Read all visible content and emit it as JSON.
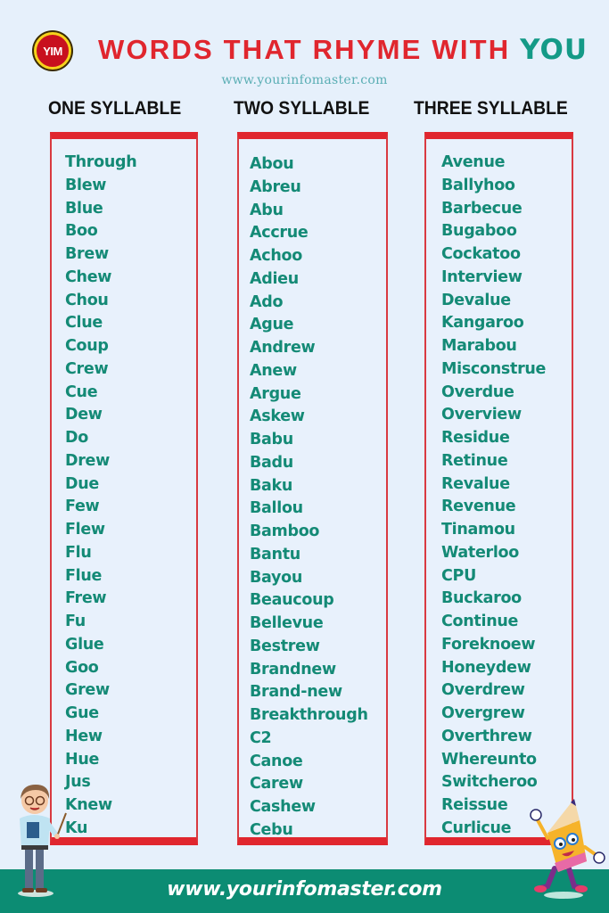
{
  "header": {
    "logo_text": "YIM",
    "title_main": "WORDS THAT RHYME WITH ",
    "title_accent": "YOU",
    "subtitle": "www.yourinfomaster.com"
  },
  "colors": {
    "title_red": "#e0262e",
    "accent_teal": "#149a87",
    "word_green": "#148a76",
    "footer_green": "#0c8c73",
    "background": "#e6f0fb"
  },
  "columns": [
    {
      "header": "ONE SYLLABLE",
      "words": [
        "Through",
        "Blew",
        "Blue",
        "Boo",
        "Brew",
        "Chew",
        "Chou",
        "Clue",
        "Coup",
        "Crew",
        "Cue",
        "Dew",
        "Do",
        "Drew",
        "Due",
        "Few",
        "Flew",
        "Flu",
        "Flue",
        "Frew",
        "Fu",
        "Glue",
        "Goo",
        "Grew",
        "Gue",
        "Hew",
        "Hue",
        "Jus",
        "Knew",
        "Ku"
      ]
    },
    {
      "header": "TWO SYLLABLE",
      "words": [
        "Abou",
        "Abreu",
        "Abu",
        "Accrue",
        "Achoo",
        "Adieu",
        "Ado",
        "Ague",
        "Andrew",
        "Anew",
        "Argue",
        "Askew",
        "Babu",
        "Badu",
        "Baku",
        "Ballou",
        "Bamboo",
        "Bantu",
        "Bayou",
        "Beaucoup",
        "Bellevue",
        "Bestrew",
        "Brandnew",
        "Brand-new",
        "Breakthrough",
        "C2",
        "Canoe",
        "Carew",
        "Cashew",
        "Cebu"
      ]
    },
    {
      "header": "THREE SYLLABLE",
      "words": [
        "Avenue",
        "Ballyhoo",
        "Barbecue",
        "Bugaboo",
        "Cockatoo",
        "Interview",
        "Devalue",
        "Kangaroo",
        "Marabou",
        "Misconstrue",
        "Overdue",
        "Overview",
        "Residue",
        "Retinue",
        "Revalue",
        "Revenue",
        "Tinamou",
        "Waterloo",
        "CPU",
        "Buckaroo",
        "Continue",
        "Foreknoew",
        "Honeydew",
        "Overdrew",
        "Overgrew",
        "Overthrew",
        "Whereunto",
        "Switcheroo",
        "Reissue",
        "Curlicue"
      ]
    }
  ],
  "footer": {
    "url": "www.yourinfomaster.com"
  },
  "illustrations": {
    "left": "teacher-with-pointer",
    "right": "pencil-mascot-waving"
  }
}
